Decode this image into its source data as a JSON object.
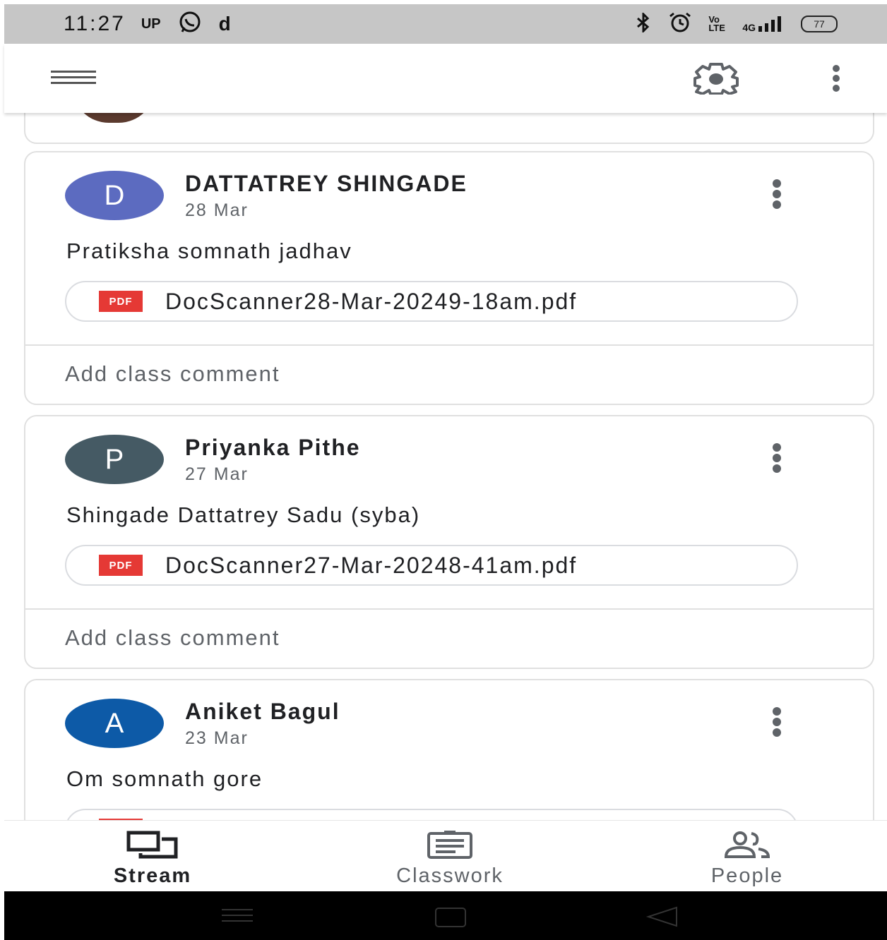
{
  "status_bar": {
    "time": "11:27",
    "carrier": "UP",
    "app_letter": "d",
    "volte": "Vo LTE",
    "network": "4G",
    "battery": "77"
  },
  "posts": [
    {
      "avatar_letter": "D",
      "avatar_color": "#5c6bc0",
      "author": "DATTATREY SHINGADE",
      "date": "28 Mar",
      "text": "Pratiksha somnath jadhav",
      "attachment": {
        "type_label": "PDF",
        "name": "DocScanner28-Mar-20249-18am.pdf"
      },
      "comment_placeholder": "Add class comment"
    },
    {
      "avatar_letter": "P",
      "avatar_color": "#455a64",
      "author": "Priyanka Pithe",
      "date": "27 Mar",
      "text": "Shingade Dattatrey Sadu (syba)",
      "attachment": {
        "type_label": "PDF",
        "name": "DocScanner27-Mar-20248-41am.pdf"
      },
      "comment_placeholder": "Add class comment"
    },
    {
      "avatar_letter": "A",
      "avatar_color": "#0d5aa7",
      "author": "Aniket Bagul",
      "date": "23 Mar",
      "text": "Om somnath gore"
    }
  ],
  "bottom_nav": {
    "stream": "Stream",
    "classwork": "Classwork",
    "people": "People"
  },
  "icons": {
    "menu": "hamburger-icon",
    "settings": "gear-icon",
    "more": "vertical-dots-icon",
    "stream": "stream-icon",
    "classwork": "assignment-icon",
    "people": "people-icon"
  }
}
